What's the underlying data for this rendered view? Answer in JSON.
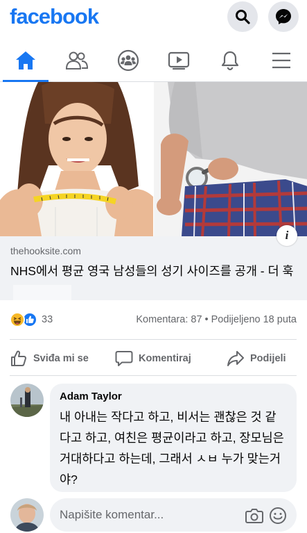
{
  "app": {
    "logo_text": "facebook",
    "brand_color": "#1877f2"
  },
  "header": {
    "search_icon": "search-icon",
    "messenger_icon": "messenger-icon"
  },
  "nav": {
    "tabs": [
      {
        "name": "home",
        "icon": "home-icon",
        "active": true
      },
      {
        "name": "friends",
        "icon": "friends-icon",
        "active": false
      },
      {
        "name": "groups",
        "icon": "groups-icon",
        "active": false
      },
      {
        "name": "watch",
        "icon": "watch-icon",
        "active": false
      },
      {
        "name": "notifications",
        "icon": "bell-icon",
        "active": false
      },
      {
        "name": "menu",
        "icon": "menu-icon",
        "active": false
      }
    ]
  },
  "post": {
    "link": {
      "domain": "thehooksite.com",
      "title": "NHS에서 평균 영국 남성들의 성기 사이즈를 공개 - 더 훅",
      "info_label": "i"
    },
    "reactions": {
      "types": [
        "haha",
        "like"
      ],
      "count": "33",
      "summary": "Komentara: 87 • Podijeljeno 18 puta"
    },
    "actions": {
      "like_label": "Sviđa mi se",
      "comment_label": "Komentiraj",
      "share_label": "Podijeli"
    }
  },
  "comment": {
    "author": "Adam Taylor",
    "text": "내 아내는 작다고 하고, 비서는 괜찮은 것 같다고 하고, 여친은 평균이라고 하고, 장모님은 거대하다고 하는데, 그래서 ㅅㅂ 누가 맞는거야?"
  },
  "composer": {
    "placeholder": "Napišite komentar...",
    "camera_icon": "camera-icon",
    "emoji_icon": "emoji-icon"
  }
}
